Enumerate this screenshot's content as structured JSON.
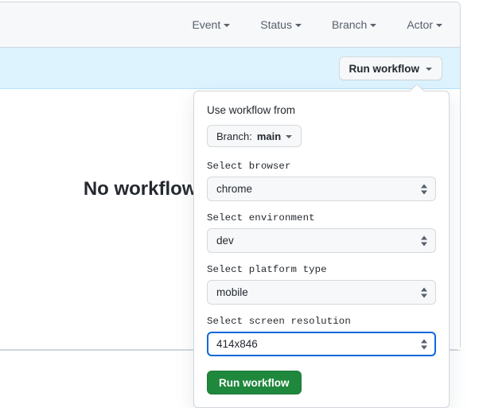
{
  "filters": [
    {
      "label": "Event",
      "icon": "chevron-down-icon"
    },
    {
      "label": "Status",
      "icon": "chevron-down-icon"
    },
    {
      "label": "Branch",
      "icon": "chevron-down-icon"
    },
    {
      "label": "Actor",
      "icon": "chevron-down-icon"
    }
  ],
  "banner": {
    "run_workflow_label": "Run workflow"
  },
  "empty_state": {
    "title": "No workflow runs yet."
  },
  "dropdown": {
    "title": "Use workflow from",
    "branch_prefix": "Branch:",
    "branch_name": "main",
    "fields": [
      {
        "label": "Select browser",
        "value": "chrome",
        "focused": false
      },
      {
        "label": "Select environment",
        "value": "dev",
        "focused": false
      },
      {
        "label": "Select platform type",
        "value": "mobile",
        "focused": false
      },
      {
        "label": "Select screen resolution",
        "value": "414x846",
        "focused": true
      }
    ],
    "submit_label": "Run workflow"
  },
  "colors": {
    "banner_bg": "#ddf4ff",
    "toolbar_bg": "#f6f8fa",
    "accent_green": "#1f883d",
    "focus_blue": "#0969da",
    "border": "#d0d7de"
  }
}
